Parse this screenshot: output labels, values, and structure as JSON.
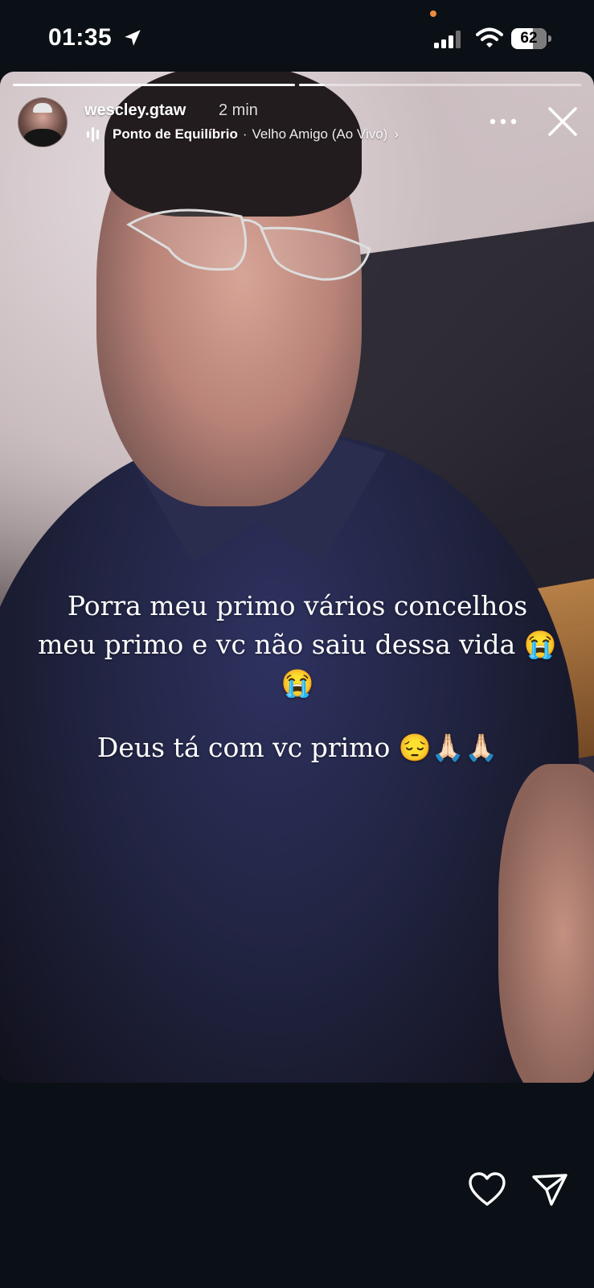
{
  "status_bar": {
    "time": "01:35",
    "battery_percent": "62",
    "battery_level": 0.62,
    "icons": [
      "location-arrow-icon",
      "signal-icon",
      "wifi-icon",
      "battery-icon"
    ]
  },
  "story": {
    "progress": [
      {
        "segment": 1,
        "fill": 1.0
      },
      {
        "segment": 2,
        "fill": 0.09
      }
    ],
    "username": "wescley.gtaw",
    "time_ago": "2 min",
    "music": {
      "artist": "Ponto de Equilíbrio",
      "separator": "·",
      "song": "Velho Amigo (Ao Vivo)",
      "chevron": "›"
    },
    "caption": {
      "line1": "Porra meu primo vários concelhos",
      "line2": "meu primo e vc não saiu dessa vida 😭",
      "line3": "😭",
      "line4": "Deus tá com vc primo 😔🙏🏻🙏🏻"
    }
  },
  "actions": {
    "icons": [
      "heart-icon",
      "send-icon"
    ]
  },
  "colors": {
    "background": "#0b1016",
    "text": "#ffffff",
    "status_dot": "#f08a3c"
  }
}
